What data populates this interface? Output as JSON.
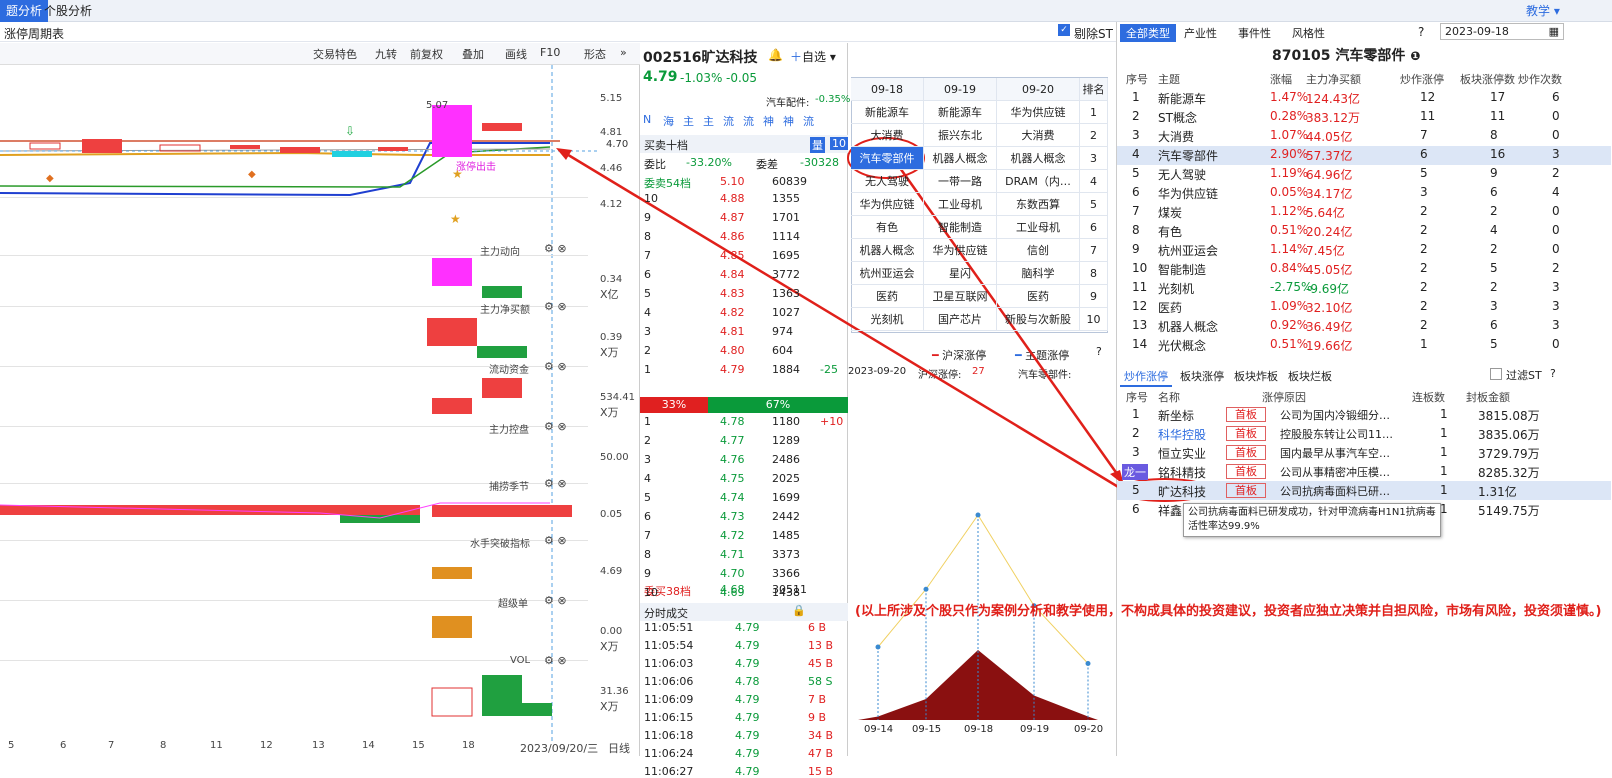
{
  "top_tabs": [
    "题分析",
    "个股分析"
  ],
  "help_label": "教学",
  "subtitle": "涨停周期表",
  "exclude_st": "剔除ST",
  "toolbar": [
    "交易特色",
    "九转",
    "前复权",
    "叠加",
    "画线",
    "F10",
    "形态"
  ],
  "price_axis": [
    "5.15",
    "4.81",
    "4.70",
    "4.46",
    "4.12"
  ],
  "price_annot": [
    "5.07",
    "涨停出击"
  ],
  "indicators": [
    {
      "name": "主力动向",
      "val": "0.34",
      "unit": "X亿"
    },
    {
      "name": "主力净买额",
      "val": "0.39",
      "unit": "X万"
    },
    {
      "name": "流动资金",
      "val": "534.41",
      "unit": "X万"
    },
    {
      "name": "主力控盘",
      "val": "50.00",
      "unit": ""
    },
    {
      "name": "捕捞季节",
      "val": "0.05",
      "unit": ""
    },
    {
      "name": "水手突破指标",
      "val": "4.69",
      "unit": ""
    },
    {
      "name": "超级单",
      "val": "0.00",
      "unit": "X万"
    },
    {
      "name": "VOL",
      "val": "31.36",
      "unit": "X万"
    }
  ],
  "xaxis": [
    "5",
    "6",
    "7",
    "8",
    "11",
    "12",
    "13",
    "14",
    "15",
    "18"
  ],
  "date_label": "2023/09/20/三",
  "day_line": "日线",
  "stock": {
    "code_name": "002516旷达科技",
    "add": "自选",
    "price": "4.79",
    "chg": "-1.03%",
    "chgv": "-0.05",
    "sector": "汽车配件:",
    "sector_chg": "-0.35%"
  },
  "ob_icons": [
    "N",
    "海",
    "主",
    "主",
    "流",
    "流",
    "神",
    "神",
    "流"
  ],
  "ob_title": "买卖十档",
  "ob_level_count": "10",
  "ob_ratio": {
    "wb_label": "委比",
    "wb": "-33.20%",
    "wc_label": "委差",
    "wc": "-30328"
  },
  "sell_total": {
    "label": "委卖54档",
    "price": "5.10",
    "vol": "60839"
  },
  "asks": [
    [
      "10",
      "4.88",
      "1355"
    ],
    [
      "9",
      "4.87",
      "1701"
    ],
    [
      "8",
      "4.86",
      "1114"
    ],
    [
      "7",
      "4.85",
      "1695"
    ],
    [
      "6",
      "4.84",
      "3772"
    ],
    [
      "5",
      "4.83",
      "1363"
    ],
    [
      "4",
      "4.82",
      "1027"
    ],
    [
      "3",
      "4.81",
      "974"
    ],
    [
      "2",
      "4.80",
      "604"
    ],
    [
      "1",
      "4.79",
      "1884",
      "-25"
    ]
  ],
  "bar_split": [
    "33%",
    "67%"
  ],
  "bids": [
    [
      "1",
      "4.78",
      "1180",
      "+10"
    ],
    [
      "2",
      "4.77",
      "1289"
    ],
    [
      "3",
      "4.76",
      "2486"
    ],
    [
      "4",
      "4.75",
      "2025"
    ],
    [
      "5",
      "4.74",
      "1699"
    ],
    [
      "6",
      "4.73",
      "2442"
    ],
    [
      "7",
      "4.72",
      "1485"
    ],
    [
      "8",
      "4.71",
      "3373"
    ],
    [
      "9",
      "4.70",
      "3366"
    ],
    [
      "10",
      "4.69",
      "1438"
    ]
  ],
  "buy_total": {
    "label": "委买38档",
    "price": "4.68",
    "vol": "30511"
  },
  "ticks_title": "分时成交",
  "ticks": [
    [
      "11:05:51",
      "4.79",
      "6 B"
    ],
    [
      "11:05:54",
      "4.79",
      "13 B"
    ],
    [
      "11:06:03",
      "4.79",
      "45 B"
    ],
    [
      "11:06:06",
      "4.78",
      "58 S"
    ],
    [
      "11:06:09",
      "4.79",
      "7 B"
    ],
    [
      "11:06:15",
      "4.79",
      "9 B"
    ],
    [
      "11:06:18",
      "4.79",
      "34 B"
    ],
    [
      "11:06:24",
      "4.79",
      "47 B"
    ],
    [
      "11:06:27",
      "4.79",
      "15 B"
    ]
  ],
  "matrix_head": [
    "09-18",
    "09-19",
    "09-20",
    "排名"
  ],
  "matrix": [
    [
      "新能源车",
      "新能源车",
      "华为供应链",
      "1"
    ],
    [
      "大消费",
      "振兴东北",
      "大消费",
      "2"
    ],
    [
      "汽车零部件",
      "机器人概念",
      "机器人概念",
      "3"
    ],
    [
      "无人驾驶",
      "一带一路",
      "DRAM（内…",
      "4"
    ],
    [
      "华为供应链",
      "工业母机",
      "东数西算",
      "5"
    ],
    [
      "有色",
      "智能制造",
      "工业母机",
      "6"
    ],
    [
      "机器人概念",
      "华为供应链",
      "信创",
      "7"
    ],
    [
      "杭州亚运会",
      "星闪",
      "脑科学",
      "8"
    ],
    [
      "医药",
      "卫星互联网",
      "医药",
      "9"
    ],
    [
      "光刻机",
      "国产芯片",
      "新股与次新股",
      "10"
    ]
  ],
  "mid_legend": {
    "a": "沪深涨停",
    "b": "主题涨停",
    "date": "2023-09-20",
    "hs": "沪深涨停:",
    "hs_val": "27",
    "sec": "汽车零部件:"
  },
  "mid_x": [
    "09-14",
    "09-15",
    "09-18",
    "09-19",
    "09-20"
  ],
  "mid_line": [
    0.2,
    0.55,
    1.0,
    0.45,
    0.1
  ],
  "mid_area": [
    0.05,
    0.3,
    1.0,
    0.35,
    0.05
  ],
  "disclaimer": "(以上所涉及个股只作为案例分析和教学使用，不构成具体的投资建议，投资者应独立决策并自担风险，市场有风险，投资须谨慎。)",
  "right_tabs": [
    "全部类型",
    "产业性",
    "事件性",
    "风格性"
  ],
  "right_date": "2023-09-18",
  "right_title": "870105 汽车零部件",
  "right_head": [
    "序号",
    "主题",
    "涨幅",
    "主力净买额",
    "炒作涨停",
    "板块涨停数",
    "炒作次数"
  ],
  "right_rows": [
    [
      "1",
      "新能源车",
      "1.47%",
      "124.43亿",
      "12",
      "17",
      "6"
    ],
    [
      "2",
      "ST概念",
      "0.28%",
      "383.12万",
      "11",
      "11",
      "0"
    ],
    [
      "3",
      "大消费",
      "1.07%",
      "44.05亿",
      "7",
      "8",
      "0"
    ],
    [
      "4",
      "汽车零部件",
      "2.90%",
      "57.37亿",
      "6",
      "16",
      "3"
    ],
    [
      "5",
      "无人驾驶",
      "1.19%",
      "64.96亿",
      "5",
      "9",
      "2"
    ],
    [
      "6",
      "华为供应链",
      "0.05%",
      "34.17亿",
      "3",
      "6",
      "4"
    ],
    [
      "7",
      "煤炭",
      "1.12%",
      "5.64亿",
      "2",
      "2",
      "0"
    ],
    [
      "8",
      "有色",
      "0.51%",
      "20.24亿",
      "2",
      "4",
      "0"
    ],
    [
      "9",
      "杭州亚运会",
      "1.14%",
      "7.45亿",
      "2",
      "2",
      "0"
    ],
    [
      "10",
      "智能制造",
      "0.84%",
      "45.05亿",
      "2",
      "5",
      "2"
    ],
    [
      "11",
      "光刻机",
      "-2.75%",
      "-9.69亿",
      "2",
      "2",
      "3"
    ],
    [
      "12",
      "医药",
      "1.09%",
      "32.10亿",
      "2",
      "3",
      "3"
    ],
    [
      "13",
      "机器人概念",
      "0.92%",
      "36.49亿",
      "2",
      "6",
      "3"
    ],
    [
      "14",
      "光伏概念",
      "0.51%",
      "19.66亿",
      "1",
      "5",
      "0"
    ]
  ],
  "lim_tabs": [
    "炒作涨停",
    "板块涨停",
    "板块炸板",
    "板块烂板"
  ],
  "lim_filter": "过滤ST",
  "lim_head": [
    "序号",
    "名称",
    "涨停原因",
    "连板数",
    "封板金额"
  ],
  "lim_rows": [
    [
      "1",
      "新坐标",
      "首板",
      "公司为国内冷锻细分…",
      "1",
      "3815.08万"
    ],
    [
      "2",
      "科华控股",
      "首板",
      "控股股东转让公司11…",
      "1",
      "3835.06万"
    ],
    [
      "3",
      "恒立实业",
      "首板",
      "国内最早从事汽车空…",
      "1",
      "3729.79万"
    ],
    [
      "龙一",
      "铭科精技",
      "首板",
      "公司从事精密冲压模…",
      "1",
      "8285.32万"
    ],
    [
      "5",
      "旷达科技",
      "首板",
      "公司抗病毒面料已研…",
      "1",
      "1.31亿"
    ],
    [
      "6",
      "祥鑫",
      "",
      "",
      "1",
      "5149.75万"
    ]
  ],
  "tooltip": "公司抗病毒面料已研发成功，针对甲流病毒H1N1抗病毒活性率达99.9%"
}
